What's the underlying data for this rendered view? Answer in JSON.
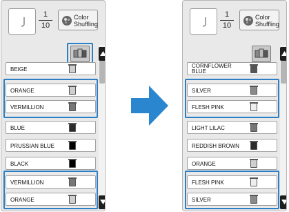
{
  "colors": {
    "highlight": "#2c7fc4",
    "arrow": "#2a86cf"
  },
  "screens": {
    "left": {
      "fraction_numerator": "1",
      "fraction_denominator": "10",
      "color_shuffling_label": "Color\nShuffling",
      "threads": [
        {
          "label": "BEIGE",
          "spool_color": "#cfcfcf"
        },
        {
          "label": "ORANGE",
          "spool_color": "#cfcfcf"
        },
        {
          "label": "VERMILLION",
          "spool_color": "#777777"
        },
        {
          "label": "BLUE",
          "spool_color": "#2b2b2b"
        },
        {
          "label": "PRUSSIAN BLUE",
          "spool_color": "#000000"
        },
        {
          "label": "BLACK",
          "spool_color": "#000000"
        },
        {
          "label": "VERMILLION",
          "spool_color": "#777777"
        },
        {
          "label": "ORANGE",
          "spool_color": "#cfcfcf"
        }
      ]
    },
    "right": {
      "fraction_numerator": "1",
      "fraction_denominator": "10",
      "color_shuffling_label": "Color\nShuffling",
      "threads": [
        {
          "label": "CORNFLOWER\nBLUE",
          "spool_color": "#555555"
        },
        {
          "label": "SILVER",
          "spool_color": "#8a8a8a"
        },
        {
          "label": "FLESH PINK",
          "spool_color": "#eeeeee"
        },
        {
          "label": "LIGHT LILAC",
          "spool_color": "#777777"
        },
        {
          "label": "REDDISH BROWN",
          "spool_color": "#2b2b2b"
        },
        {
          "label": "ORANGE",
          "spool_color": "#cfcfcf"
        },
        {
          "label": "FLESH PINK",
          "spool_color": "#eeeeee"
        },
        {
          "label": "SILVER",
          "spool_color": "#8a8a8a"
        }
      ]
    }
  }
}
